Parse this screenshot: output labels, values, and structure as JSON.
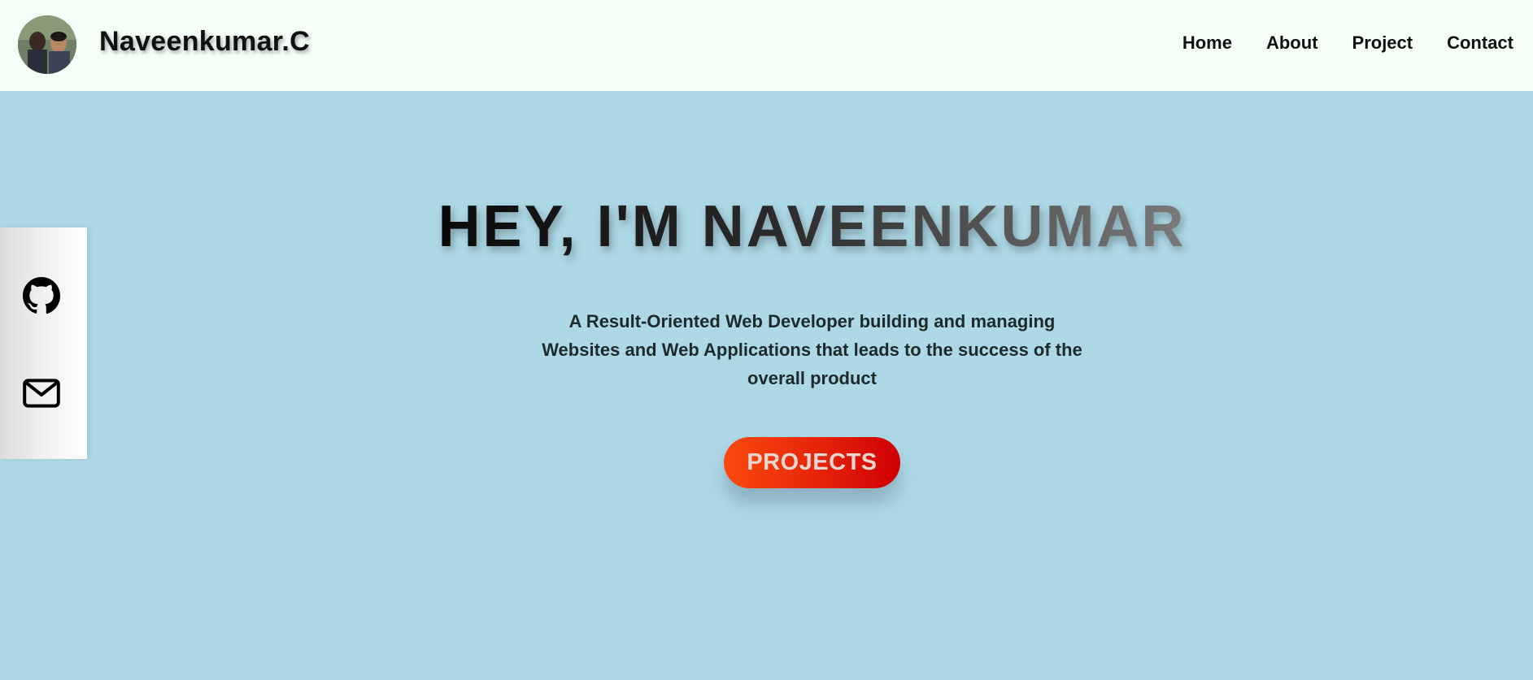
{
  "header": {
    "brand": "Naveenkumar.C",
    "nav": [
      "Home",
      "About",
      "Project",
      "Contact"
    ]
  },
  "social": {
    "icons": [
      "github-icon",
      "mail-icon"
    ]
  },
  "hero": {
    "title": "HEY, I'M NAVEENKUMAR",
    "subtitle": "A Result-Oriented Web Developer building and managing Websites and Web Applications that leads to the success of the overall product",
    "cta_label": "PROJECTS"
  },
  "colors": {
    "page_background": "#add8e6",
    "header_background": "#f5fff8",
    "cta_gradient_start": "#fa4b0e",
    "cta_gradient_end": "#cf0003"
  }
}
